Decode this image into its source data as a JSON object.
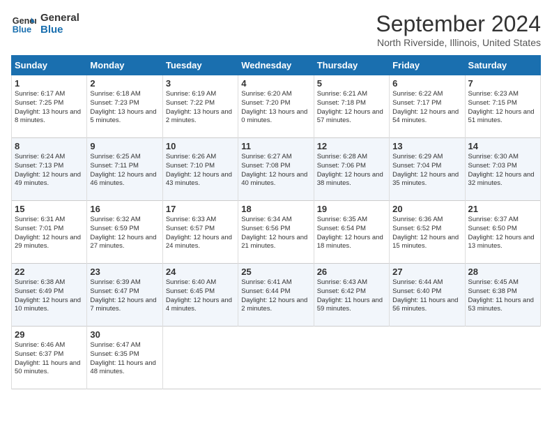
{
  "logo": {
    "text_general": "General",
    "text_blue": "Blue"
  },
  "title": "September 2024",
  "subtitle": "North Riverside, Illinois, United States",
  "days_of_week": [
    "Sunday",
    "Monday",
    "Tuesday",
    "Wednesday",
    "Thursday",
    "Friday",
    "Saturday"
  ],
  "weeks": [
    [
      {
        "day": "1",
        "sunrise": "6:17 AM",
        "sunset": "7:25 PM",
        "daylight": "13 hours and 8 minutes."
      },
      {
        "day": "2",
        "sunrise": "6:18 AM",
        "sunset": "7:23 PM",
        "daylight": "13 hours and 5 minutes."
      },
      {
        "day": "3",
        "sunrise": "6:19 AM",
        "sunset": "7:22 PM",
        "daylight": "13 hours and 2 minutes."
      },
      {
        "day": "4",
        "sunrise": "6:20 AM",
        "sunset": "7:20 PM",
        "daylight": "13 hours and 0 minutes."
      },
      {
        "day": "5",
        "sunrise": "6:21 AM",
        "sunset": "7:18 PM",
        "daylight": "12 hours and 57 minutes."
      },
      {
        "day": "6",
        "sunrise": "6:22 AM",
        "sunset": "7:17 PM",
        "daylight": "12 hours and 54 minutes."
      },
      {
        "day": "7",
        "sunrise": "6:23 AM",
        "sunset": "7:15 PM",
        "daylight": "12 hours and 51 minutes."
      }
    ],
    [
      {
        "day": "8",
        "sunrise": "6:24 AM",
        "sunset": "7:13 PM",
        "daylight": "12 hours and 49 minutes."
      },
      {
        "day": "9",
        "sunrise": "6:25 AM",
        "sunset": "7:11 PM",
        "daylight": "12 hours and 46 minutes."
      },
      {
        "day": "10",
        "sunrise": "6:26 AM",
        "sunset": "7:10 PM",
        "daylight": "12 hours and 43 minutes."
      },
      {
        "day": "11",
        "sunrise": "6:27 AM",
        "sunset": "7:08 PM",
        "daylight": "12 hours and 40 minutes."
      },
      {
        "day": "12",
        "sunrise": "6:28 AM",
        "sunset": "7:06 PM",
        "daylight": "12 hours and 38 minutes."
      },
      {
        "day": "13",
        "sunrise": "6:29 AM",
        "sunset": "7:04 PM",
        "daylight": "12 hours and 35 minutes."
      },
      {
        "day": "14",
        "sunrise": "6:30 AM",
        "sunset": "7:03 PM",
        "daylight": "12 hours and 32 minutes."
      }
    ],
    [
      {
        "day": "15",
        "sunrise": "6:31 AM",
        "sunset": "7:01 PM",
        "daylight": "12 hours and 29 minutes."
      },
      {
        "day": "16",
        "sunrise": "6:32 AM",
        "sunset": "6:59 PM",
        "daylight": "12 hours and 27 minutes."
      },
      {
        "day": "17",
        "sunrise": "6:33 AM",
        "sunset": "6:57 PM",
        "daylight": "12 hours and 24 minutes."
      },
      {
        "day": "18",
        "sunrise": "6:34 AM",
        "sunset": "6:56 PM",
        "daylight": "12 hours and 21 minutes."
      },
      {
        "day": "19",
        "sunrise": "6:35 AM",
        "sunset": "6:54 PM",
        "daylight": "12 hours and 18 minutes."
      },
      {
        "day": "20",
        "sunrise": "6:36 AM",
        "sunset": "6:52 PM",
        "daylight": "12 hours and 15 minutes."
      },
      {
        "day": "21",
        "sunrise": "6:37 AM",
        "sunset": "6:50 PM",
        "daylight": "12 hours and 13 minutes."
      }
    ],
    [
      {
        "day": "22",
        "sunrise": "6:38 AM",
        "sunset": "6:49 PM",
        "daylight": "12 hours and 10 minutes."
      },
      {
        "day": "23",
        "sunrise": "6:39 AM",
        "sunset": "6:47 PM",
        "daylight": "12 hours and 7 minutes."
      },
      {
        "day": "24",
        "sunrise": "6:40 AM",
        "sunset": "6:45 PM",
        "daylight": "12 hours and 4 minutes."
      },
      {
        "day": "25",
        "sunrise": "6:41 AM",
        "sunset": "6:44 PM",
        "daylight": "12 hours and 2 minutes."
      },
      {
        "day": "26",
        "sunrise": "6:43 AM",
        "sunset": "6:42 PM",
        "daylight": "11 hours and 59 minutes."
      },
      {
        "day": "27",
        "sunrise": "6:44 AM",
        "sunset": "6:40 PM",
        "daylight": "11 hours and 56 minutes."
      },
      {
        "day": "28",
        "sunrise": "6:45 AM",
        "sunset": "6:38 PM",
        "daylight": "11 hours and 53 minutes."
      }
    ],
    [
      {
        "day": "29",
        "sunrise": "6:46 AM",
        "sunset": "6:37 PM",
        "daylight": "11 hours and 50 minutes."
      },
      {
        "day": "30",
        "sunrise": "6:47 AM",
        "sunset": "6:35 PM",
        "daylight": "11 hours and 48 minutes."
      },
      null,
      null,
      null,
      null,
      null
    ]
  ]
}
